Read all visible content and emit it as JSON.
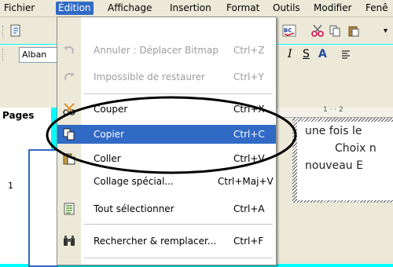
{
  "menubar": {
    "items": [
      "Fichier",
      "Édition",
      "Affichage",
      "Insertion",
      "Format",
      "Outils",
      "Modifier",
      "Fenê"
    ]
  },
  "toolbar": {
    "font_name": "Alban",
    "italic": "I",
    "strike": "S"
  },
  "pages_panel": {
    "title": "Pages",
    "slide_number": "1"
  },
  "menu": {
    "items": [
      {
        "label": "Annuler : Déplacer Bitmap",
        "shortcut": "Ctrl+Z",
        "icon": "undo-icon",
        "disabled": true
      },
      {
        "label": "Impossible de restaurer",
        "shortcut": "Ctrl+Y",
        "icon": "redo-icon",
        "disabled": true
      },
      {
        "label": "Couper",
        "shortcut": "Ctrl+X",
        "icon": "scissors-icon"
      },
      {
        "label": "Copier",
        "shortcut": "Ctrl+C",
        "icon": "copy-icon",
        "highlighted": true
      },
      {
        "label": "Coller",
        "shortcut": "Ctrl+V",
        "icon": "paste-icon"
      },
      {
        "label": "Collage spécial...",
        "shortcut": "Ctrl+Maj+V",
        "icon": ""
      },
      {
        "label": "Tout sélectionner",
        "shortcut": "Ctrl+A",
        "icon": "select-all-icon"
      },
      {
        "label": "Rechercher & remplacer...",
        "shortcut": "Ctrl+F",
        "icon": "binoculars-icon"
      }
    ]
  },
  "document": {
    "lines": [
      "une fois le",
      "Choix n",
      "nouveau E"
    ],
    "ruler": "1 · · 2"
  },
  "colors": {
    "highlight": "#316ac5",
    "background": "#00ffff",
    "annotation_ellipse": "#000000"
  }
}
